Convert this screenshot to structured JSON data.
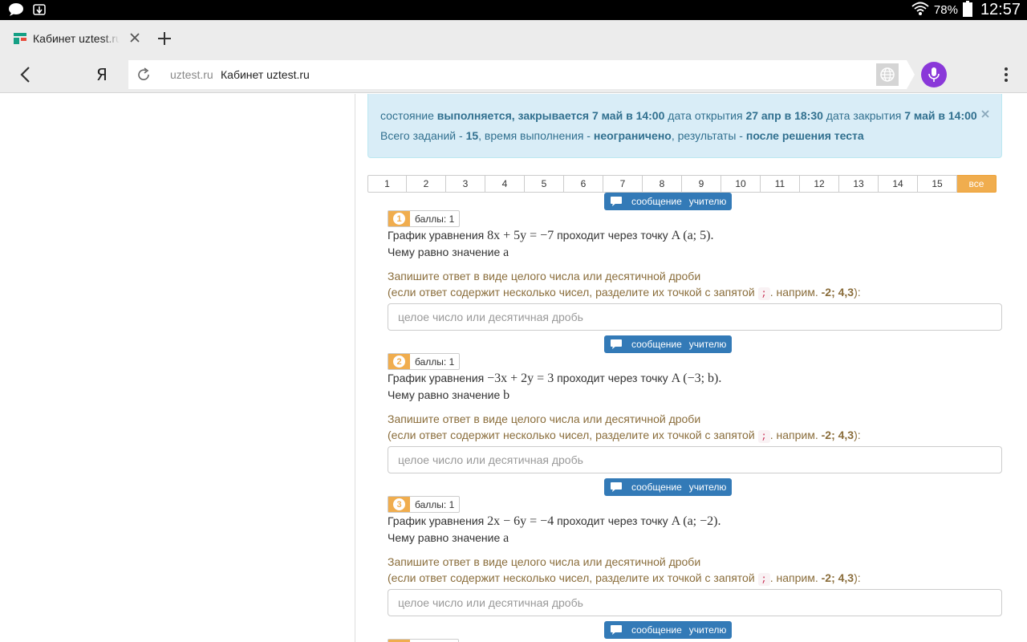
{
  "status_bar": {
    "battery": "78%",
    "time": "12:57"
  },
  "tab": {
    "title": "Кабинет uztest.ru"
  },
  "address_bar": {
    "search_logo": "Я",
    "domain": "uztest.ru",
    "page_title": "Кабинет uztest.ru"
  },
  "alert": {
    "state_label": "состояние",
    "state_value": "выполняется, закрывается 7 май в 14:00",
    "open_label": "дата открытия",
    "open_value": "27 апр в 18:30",
    "close_label": "дата закрытия",
    "close_value": "7 май в 14:00",
    "total_label": "Всего заданий -",
    "total_value": "15",
    "time_label": ", время выполнения -",
    "time_value": "неограничено",
    "results_label": ", результаты -",
    "results_value": "после решения теста"
  },
  "pager": [
    "1",
    "2",
    "3",
    "4",
    "5",
    "6",
    "7",
    "8",
    "9",
    "10",
    "11",
    "12",
    "13",
    "14",
    "15",
    "все"
  ],
  "message_button": {
    "word1": "сообщение",
    "word2": "учителю"
  },
  "questions": [
    {
      "number": "1",
      "points": "баллы: 1",
      "prefix": "График уравнения",
      "equation": "8x + 5y = −7",
      "through": "проходит через точку",
      "point": "A (a; 5).",
      "ask": "Чему равно значение",
      "variable": "a"
    },
    {
      "number": "2",
      "points": "баллы: 1",
      "prefix": "График уравнения",
      "equation": "−3x + 2y = 3",
      "through": "проходит через точку",
      "point": "A (−3; b).",
      "ask": "Чему равно значение",
      "variable": "b"
    },
    {
      "number": "3",
      "points": "баллы: 1",
      "prefix": "График уравнения",
      "equation": "2x − 6y = −4",
      "through": "проходит через точку",
      "point": "A (a; −2).",
      "ask": "Чему равно значение",
      "variable": "a"
    }
  ],
  "answer_hint": {
    "line1": "Запишите ответ в виде целого числа или десятичной дроби",
    "line2_start": "(если ответ содержит несколько чисел, разделите их точкой с запятой",
    "separator": ";",
    "line2_mid": ". наприм.",
    "example": "-2; 4,3",
    "line2_end": "):"
  },
  "answer_input": {
    "placeholder": "целое число или десятичная дробь"
  },
  "colors": {
    "accent_orange": "#f0ad4e",
    "button_blue": "#337ab7",
    "alert_bg": "#d9edf7",
    "hint_brown": "#8a6d3b",
    "mic_purple": "#8a38d9"
  }
}
